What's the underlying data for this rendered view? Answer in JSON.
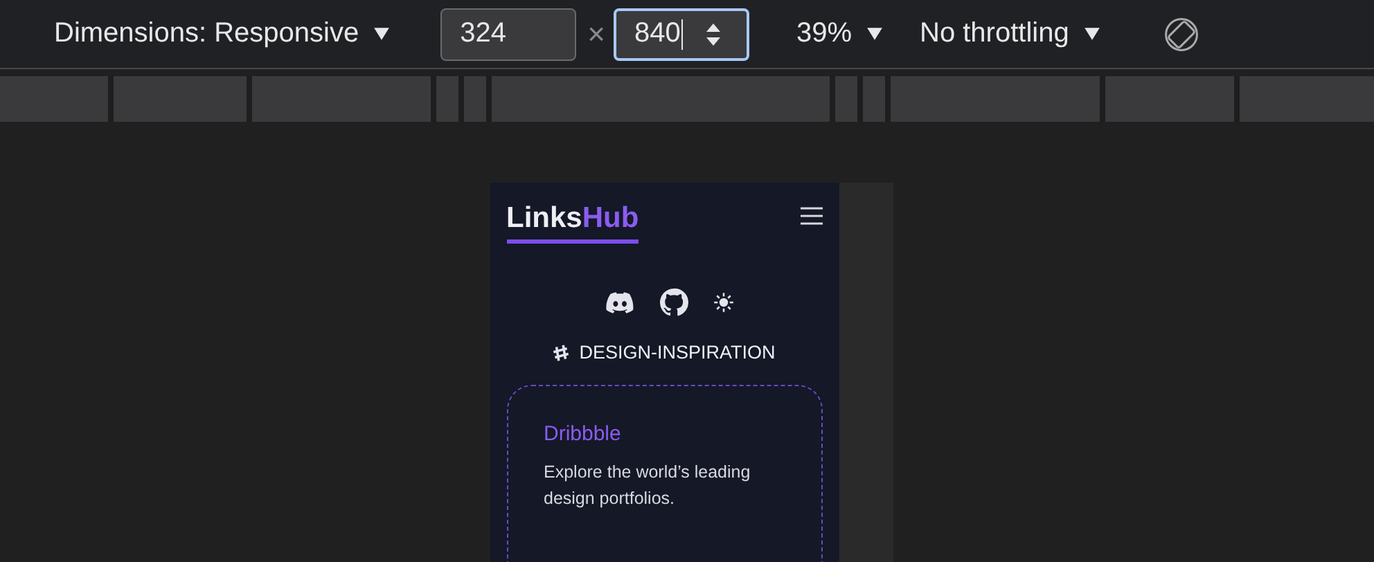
{
  "toolbar": {
    "dimensions_label": "Dimensions: Responsive",
    "width": {
      "value": "324",
      "focused": false
    },
    "separator": "×",
    "height": {
      "value": "840",
      "focused": true
    },
    "zoom": "39%",
    "throttling": "No throttling"
  },
  "viewport": {
    "logo": {
      "text": "Links",
      "accent": "Hub"
    },
    "section_title": "DESIGN-INSPIRATION",
    "cards": [
      {
        "title": "Dribbble",
        "description": "Explore the world’s leading design portfolios."
      }
    ]
  }
}
